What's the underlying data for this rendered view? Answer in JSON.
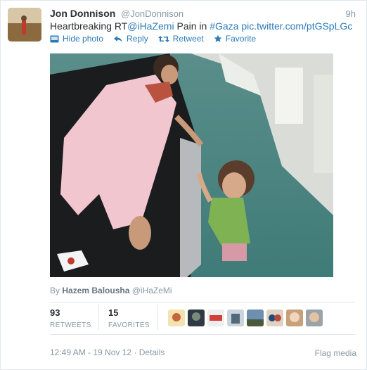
{
  "tweet": {
    "author_name": "Jon Donnison",
    "handle": "@JonDonnison",
    "time": "9h",
    "text_prefix": "Heartbreaking RT",
    "mention": "@iHaZemi",
    "text_middle": " Pain in ",
    "hashtag": "#Gaza",
    "text_space": " ",
    "link": "pic.twitter.com/ptGSpLGc"
  },
  "actions": {
    "hide_photo": "Hide photo",
    "reply": "Reply",
    "retweet": "Retweet",
    "favorite": "Favorite"
  },
  "photo": {
    "byline_prefix": "By",
    "byline_name": "Hazem Balousha",
    "byline_handle": "@iHaZeMi"
  },
  "stats": {
    "retweets_count": "93",
    "retweets_label": "RETWEETS",
    "favorites_count": "15",
    "favorites_label": "FAVORITES"
  },
  "footer": {
    "timestamp": "12:49 AM - 19 Nov 12",
    "separator": " · ",
    "details": "Details",
    "flag_media": "Flag media"
  },
  "colors": {
    "link": "#2b7bb9",
    "muted": "#8899a6",
    "text": "#292f33"
  }
}
